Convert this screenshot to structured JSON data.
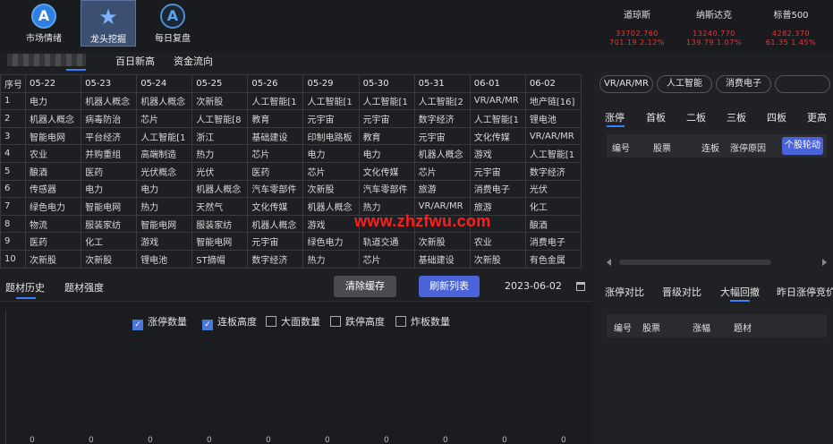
{
  "nav": {
    "items": [
      {
        "label": "市场情绪",
        "icon": "app-store-icon"
      },
      {
        "label": "龙头挖掘",
        "icon": "star-icon"
      },
      {
        "label": "每日复盘",
        "icon": "app-store-icon"
      }
    ]
  },
  "indices": [
    {
      "name": "道琼斯",
      "value": "33702.760",
      "change": "701.19  2.12%"
    },
    {
      "name": "纳斯达克",
      "value": "13240.770",
      "change": "139.79  1.07%"
    },
    {
      "name": "标普500",
      "value": "4282.370",
      "change": "61.35  1.45%"
    }
  ],
  "subtabs": [
    "百日新高",
    "资金流向"
  ],
  "table": {
    "headers": [
      "序号",
      "05-22",
      "05-23",
      "05-24",
      "05-25",
      "05-26",
      "05-29",
      "05-30",
      "05-31",
      "06-01",
      "06-02"
    ],
    "rows": [
      [
        "1",
        "电力",
        "机器人概念",
        "机器人概念",
        "次新股",
        "人工智能[1",
        "人工智能[1",
        "人工智能[1",
        "人工智能[2",
        "VR/AR/MR",
        "地产链[16]"
      ],
      [
        "2",
        "机器人概念",
        "病毒防治",
        "芯片",
        "人工智能[8",
        "教育",
        "元宇宙",
        "元宇宙",
        "数字经济",
        "人工智能[1",
        "锂电池"
      ],
      [
        "3",
        "智能电网",
        "平台经济",
        "人工智能[1",
        "浙江",
        "基础建设",
        "印制电路板",
        "教育",
        "元宇宙",
        "文化传媒",
        "VR/AR/MR"
      ],
      [
        "4",
        "农业",
        "并购重组",
        "高端制造",
        "热力",
        "芯片",
        "电力",
        "电力",
        "机器人概念",
        "游戏",
        "人工智能[1"
      ],
      [
        "5",
        "酿酒",
        "医药",
        "光伏概念",
        "光伏",
        "医药",
        "芯片",
        "文化传媒",
        "芯片",
        "元宇宙",
        "数字经济"
      ],
      [
        "6",
        "传感器",
        "电力",
        "电力",
        "机器人概念",
        "汽车零部件",
        "次新股",
        "汽车零部件",
        "旅游",
        "消费电子",
        "光伏"
      ],
      [
        "7",
        "绿色电力",
        "智能电网",
        "热力",
        "天然气",
        "文化传媒",
        "机器人概念",
        "热力",
        "VR/AR/MR",
        "旅游",
        "化工"
      ],
      [
        "8",
        "物流",
        "服装家纺",
        "智能电网",
        "服装家纺",
        "机器人概念",
        "游戏",
        "",
        "",
        "",
        "酿酒"
      ],
      [
        "9",
        "医药",
        "化工",
        "游戏",
        "智能电网",
        "元宇宙",
        "绿色电力",
        "轨道交通",
        "次新股",
        "农业",
        "消费电子"
      ],
      [
        "10",
        "次新股",
        "次新股",
        "锂电池",
        "ST摘帽",
        "数字经济",
        "热力",
        "芯片",
        "基础建设",
        "次新股",
        "有色金属"
      ]
    ]
  },
  "lower": {
    "tabs": [
      "题材历史",
      "题材强度"
    ],
    "clear_btn": "清除缓存",
    "refresh_btn": "刷新列表",
    "date": "2023-06-02",
    "checks": [
      {
        "label": "涨停数量",
        "checked": true
      },
      {
        "label": "连板高度",
        "checked": true
      },
      {
        "label": "大面数量",
        "checked": false
      },
      {
        "label": "跌停高度",
        "checked": false
      },
      {
        "label": "炸板数量",
        "checked": false
      }
    ],
    "zero_labels": [
      "0",
      "0",
      "0",
      "0",
      "0",
      "0",
      "0",
      "0",
      "0",
      "0"
    ]
  },
  "right": {
    "pills": [
      "VR/AR/MR",
      "人工智能",
      "消费电子",
      ""
    ],
    "tabs1": [
      "涨停",
      "首板",
      "二板",
      "三板",
      "四板",
      "更高"
    ],
    "head1": [
      "编号",
      "股票",
      "连板",
      "涨停原因"
    ],
    "rotate_btn": "个股轮动",
    "tabs2": [
      "涨停对比",
      "晋级对比",
      "大幅回撤",
      "昨日涨停竞价"
    ],
    "head2": [
      "编号",
      "股票",
      "涨幅",
      "题材"
    ]
  },
  "watermark": "www.zhzfwu.com",
  "colors": {
    "accent": "#3d7eff",
    "button_blue": "#4b63d8",
    "down_red": "#e03a3a"
  }
}
